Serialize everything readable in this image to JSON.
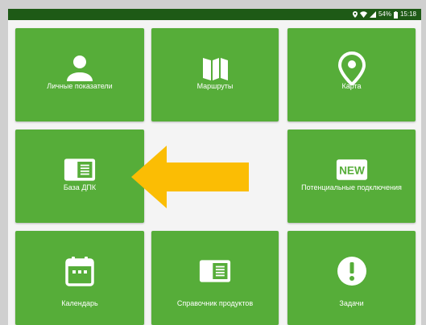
{
  "status_bar": {
    "battery": "54%",
    "time": "15:18"
  },
  "tiles": [
    {
      "label": "Личные показатели",
      "icon": "person-icon"
    },
    {
      "label": "Маршруты",
      "icon": "map-icon"
    },
    {
      "label": "Карта",
      "icon": "map-pin-icon"
    },
    {
      "label": "База ДПК",
      "icon": "book-icon"
    },
    {
      "label": "Потенциальные подключения",
      "icon": "new-badge-icon",
      "badge_text": "NEW"
    },
    {
      "label": "Календарь",
      "icon": "calendar-icon"
    },
    {
      "label": "Справочник продуктов",
      "icon": "book-icon"
    },
    {
      "label": "Задачи",
      "icon": "alert-icon"
    }
  ],
  "colors": {
    "tile": "#56ad39",
    "status_bar": "#1e5a16",
    "arrow": "#fbbd04",
    "background": "#f4f4f4"
  }
}
